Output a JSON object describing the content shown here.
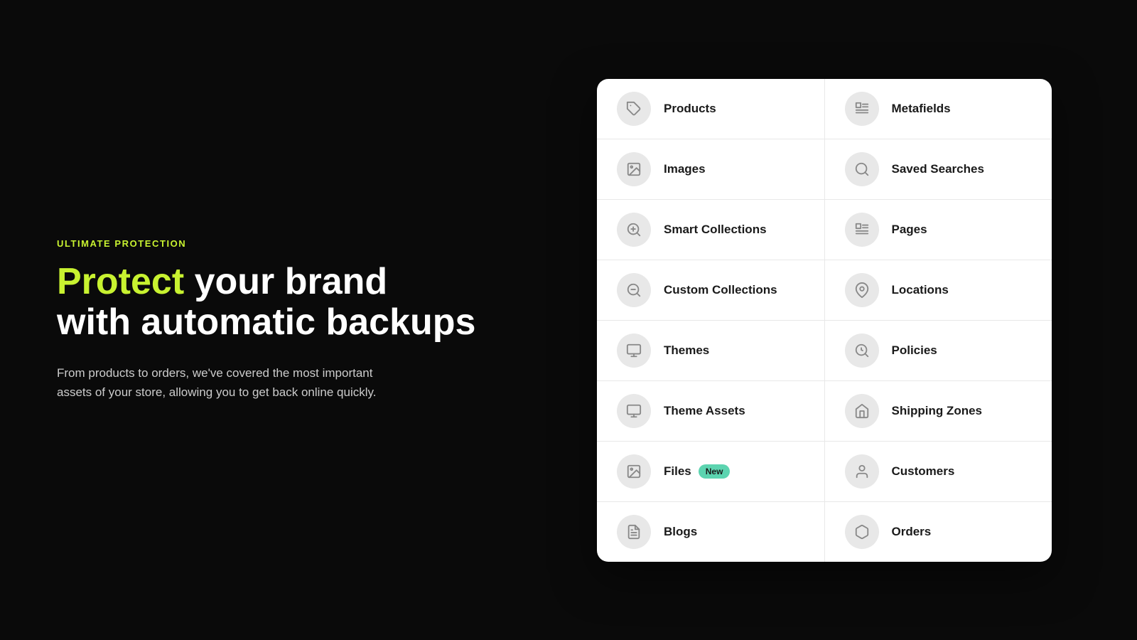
{
  "left": {
    "eyebrow": "ULTIMATE PROTECTION",
    "headline_part1": "Protect",
    "headline_part2": " your brand",
    "headline_line2": "with automatic backups",
    "subtext": "From products to orders, we've covered the most important assets of your store, allowing you to get back online quickly."
  },
  "grid": {
    "rows": [
      {
        "left": {
          "label": "Products",
          "icon": "tag",
          "badge": null
        },
        "right": {
          "label": "Metafields",
          "icon": "list-detail",
          "badge": null
        }
      },
      {
        "left": {
          "label": "Images",
          "icon": "image",
          "badge": null
        },
        "right": {
          "label": "Saved Searches",
          "icon": "search",
          "badge": null
        }
      },
      {
        "left": {
          "label": "Smart Collections",
          "icon": "smart-search",
          "badge": null
        },
        "right": {
          "label": "Pages",
          "icon": "pages",
          "badge": null
        }
      },
      {
        "left": {
          "label": "Custom Collections",
          "icon": "custom-search",
          "badge": null
        },
        "right": {
          "label": "Locations",
          "icon": "location",
          "badge": null
        }
      },
      {
        "left": {
          "label": "Themes",
          "icon": "themes",
          "badge": null
        },
        "right": {
          "label": "Policies",
          "icon": "policies",
          "badge": null
        }
      },
      {
        "left": {
          "label": "Theme Assets",
          "icon": "theme-assets",
          "badge": null
        },
        "right": {
          "label": "Shipping Zones",
          "icon": "shipping",
          "badge": null
        }
      },
      {
        "left": {
          "label": "Files",
          "icon": "files",
          "badge": "New"
        },
        "right": {
          "label": "Customers",
          "icon": "customers",
          "badge": null
        }
      },
      {
        "left": {
          "label": "Blogs",
          "icon": "blogs",
          "badge": null
        },
        "right": {
          "label": "Orders",
          "icon": "orders",
          "badge": null
        }
      }
    ]
  },
  "colors": {
    "accent": "#c8f230",
    "badge_bg": "#5cd4b0",
    "icon_bg": "#e8e8e8"
  }
}
